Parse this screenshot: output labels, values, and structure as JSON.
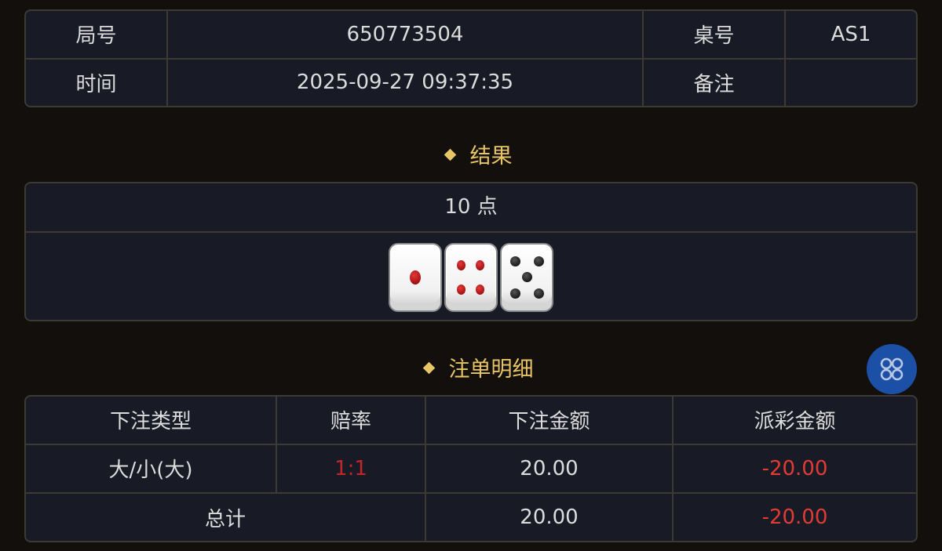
{
  "info": {
    "round_label": "局号",
    "round_value": "650773504",
    "table_label": "桌号",
    "table_value": "AS1",
    "time_label": "时间",
    "time_value": "2025-09-27 09:37:35",
    "note_label": "备注",
    "note_value": ""
  },
  "result": {
    "title": "结果",
    "points_text": "10 点",
    "dice": [
      1,
      4,
      5
    ]
  },
  "bets": {
    "title": "注单明细",
    "headers": [
      "下注类型",
      "赔率",
      "下注金额",
      "派彩金额"
    ],
    "rows": [
      {
        "type": "大/小(大)",
        "odds": "1:1",
        "amount": "20.00",
        "payout": "-20.00"
      }
    ],
    "total": {
      "label": "总计",
      "amount": "20.00",
      "payout": "-20.00"
    }
  },
  "colors": {
    "accent_gold": "#e8c565",
    "loss_red": "#e23b36",
    "float_button_blue": "#1c4fa6"
  },
  "float_button": {
    "icon": "grid-menu-icon"
  }
}
